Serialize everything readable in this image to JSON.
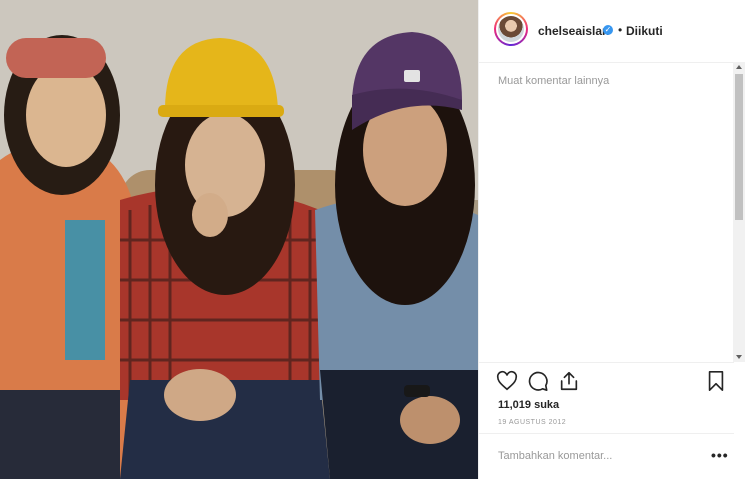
{
  "post": {
    "username": "chelseaislan",
    "verified_glyph": "✓",
    "separator": "•",
    "follow_status": "Diikuti",
    "load_more_comments": "Muat komentar lainnya",
    "likes": "11,019 suka",
    "date": "19 AGUSTUS 2012",
    "comment_placeholder": "Tambahkan komentar...",
    "more_options": "•••"
  },
  "icons": [
    "heart-icon",
    "comment-icon",
    "share-icon",
    "bookmark-icon",
    "verified-badge-icon",
    "more-options-icon"
  ],
  "colors": {
    "verified": "#3897f0",
    "muted_text": "#999999",
    "border": "#efefef"
  }
}
